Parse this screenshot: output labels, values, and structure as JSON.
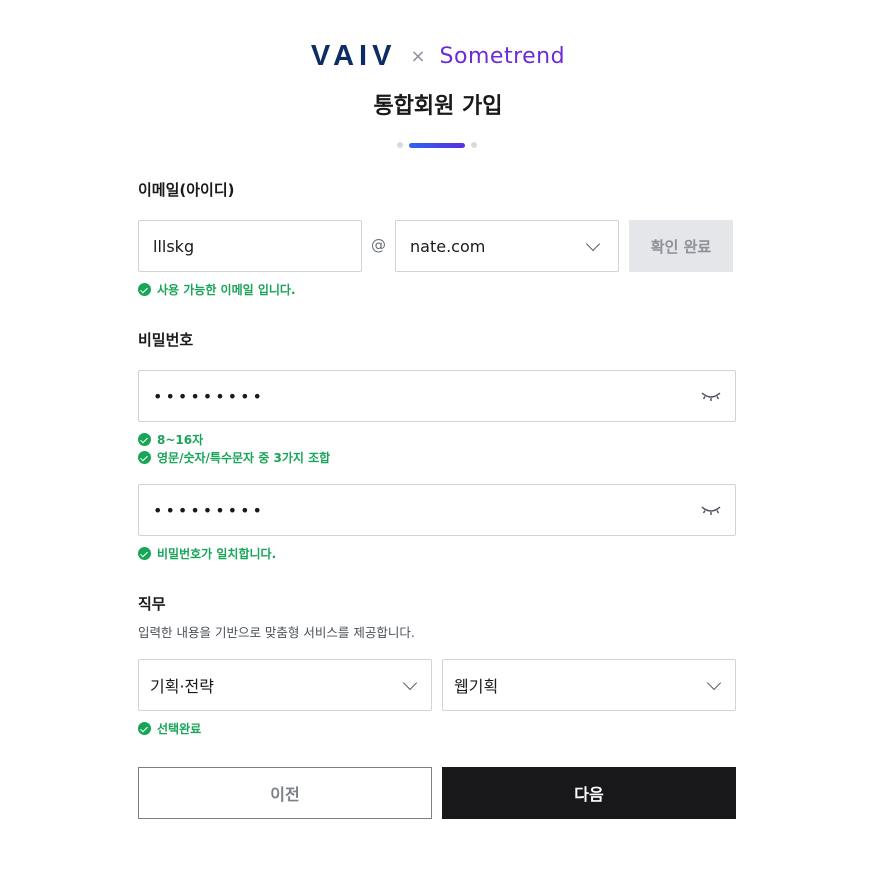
{
  "logo": {
    "brand_left": "VAIV",
    "separator": "×",
    "brand_right": "Sometrend"
  },
  "title": "통합회원 가입",
  "steps": {
    "total": 3,
    "current": 2
  },
  "email": {
    "label": "이메일(아이디)",
    "local_value": "lllskg",
    "at_symbol": "@",
    "domain_value": "nate.com",
    "confirm_label": "확인 완료",
    "status": "사용 가능한 이메일 입니다."
  },
  "password": {
    "label": "비밀번호",
    "masked_value": "•••••••••",
    "rule_length": "8~16자",
    "rule_combo": "영문/숫자/특수문자 중 3가지 조합",
    "confirm_masked_value": "•••••••••",
    "match_status": "비밀번호가 일치합니다."
  },
  "job": {
    "label": "직무",
    "description": "입력한 내용을 기반으로 맞춤형 서비스를 제공합니다.",
    "category_value": "기획·전략",
    "role_value": "웹기획",
    "status": "선택완료"
  },
  "buttons": {
    "prev_label": "이전",
    "next_label": "다음"
  },
  "colors": {
    "success": "#18a558",
    "primary_dark": "#18181b",
    "brand_purple": "#6c2bd9",
    "brand_navy": "#0c2d63"
  },
  "icons": [
    "check-circle-icon",
    "chevron-down-icon",
    "eye-closed-icon"
  ]
}
